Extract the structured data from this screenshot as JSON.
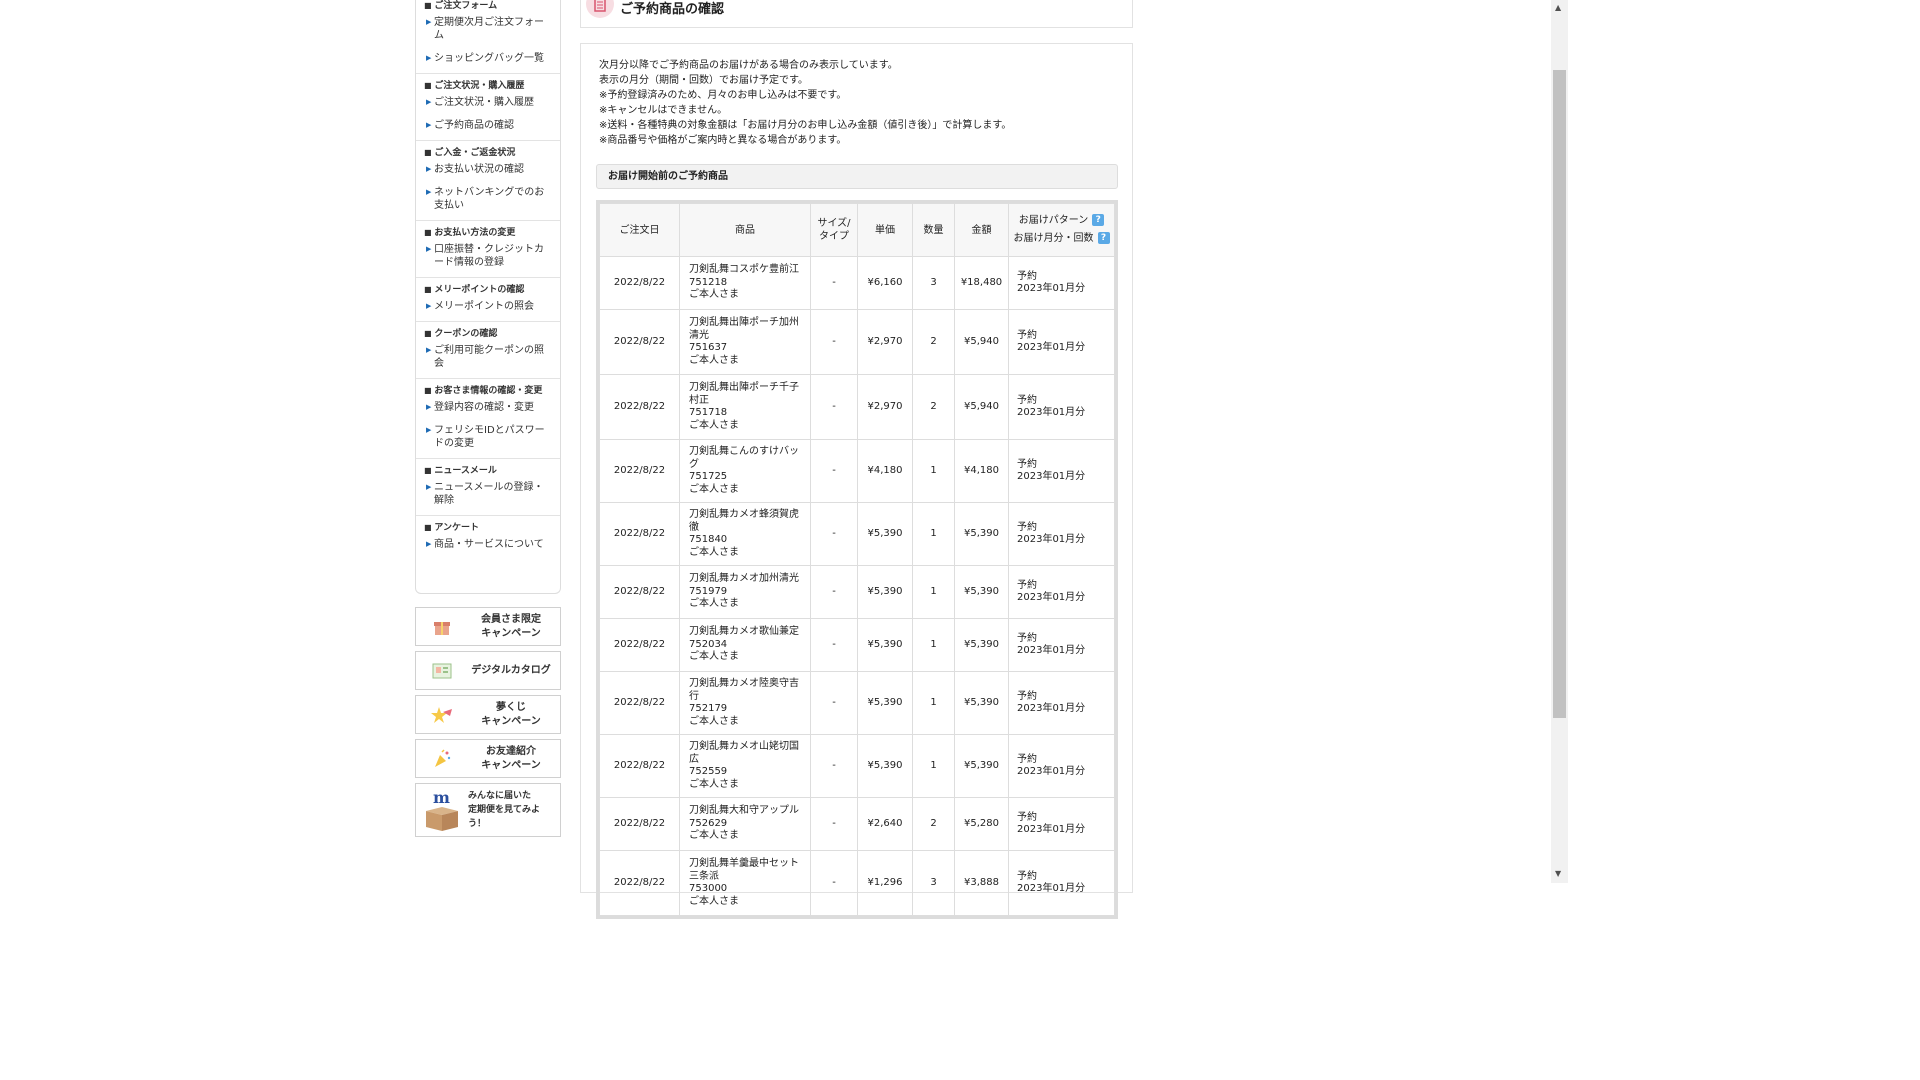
{
  "page_title": "ご予約商品の確認",
  "sidebar": {
    "sections": [
      {
        "heading": "ご注文フォーム",
        "links": [
          "定期便次月ご注文フォーム",
          "ショッピングバッグ一覧"
        ]
      },
      {
        "heading": "ご注文状況・購入履歴",
        "links": [
          "ご注文状況・購入履歴",
          "ご予約商品の確認"
        ]
      },
      {
        "heading": "ご入金・ご返金状況",
        "links": [
          "お支払い状況の確認",
          "ネットバンキングでのお支払い"
        ]
      },
      {
        "heading": "お支払い方法の変更",
        "links": [
          "口座振替・クレジットカード情報の登録"
        ]
      },
      {
        "heading": "メリーポイントの確認",
        "links": [
          "メリーポイントの照会"
        ]
      },
      {
        "heading": "クーポンの確認",
        "links": [
          "ご利用可能クーポンの照会"
        ]
      },
      {
        "heading": "お客さま情報の確認・変更",
        "links": [
          "登録内容の確認・変更",
          "フェリシモIDとパスワードの変更"
        ]
      },
      {
        "heading": "ニュースメール",
        "links": [
          "ニュースメールの登録・解除"
        ]
      },
      {
        "heading": "アンケート",
        "links": [
          "商品・サービスについて"
        ]
      }
    ]
  },
  "banners": [
    {
      "line1": "会員さま限定",
      "line2": "キャンペーン",
      "icon": "gift-icon"
    },
    {
      "line1": "デジタルカタログ",
      "line2": "",
      "icon": "catalog-icon"
    },
    {
      "line1": "夢くじ",
      "line2": "キャンペーン",
      "icon": "star-icon"
    },
    {
      "line1": "お友達紹介",
      "line2": "キャンペーン",
      "icon": "party-icon"
    },
    {
      "line1": "みんなに届いた",
      "line2": "定期便を見てみよう！",
      "icon": "box-icon"
    }
  ],
  "notes": [
    "次月分以降でご予約商品のお届けがある場合のみ表示しています。",
    "表示の月分（期間・回数）でお届け予定です。",
    "※予約登録済みのため、月々のお申し込みは不要です。",
    "※キャンセルはできません。",
    "※送料・各種特典の対象金額は「お届け月分のお申し込み金額（値引き後）」で計算します。",
    "※商品番号や価格がご案内時と異なる場合があります。"
  ],
  "section_heading": "お届け開始前のご予約商品",
  "table": {
    "headers": {
      "order_date": "ご注文日",
      "product": "商品",
      "size": "サイズ/タイプ",
      "unit_price": "単価",
      "qty": "数量",
      "amount": "金額",
      "pattern": "お届けパターン",
      "month": "お届け月分・回数",
      "help": "?"
    },
    "rows": [
      {
        "date": "2022/8/22",
        "name": "刀剣乱舞コスポケ豊前江",
        "code": "751218",
        "recipient": "ご本人さま",
        "size": "-",
        "price": "¥6,160",
        "qty": "3",
        "amount": "¥18,480",
        "pattern": "予約",
        "month": "2023年01月分"
      },
      {
        "date": "2022/8/22",
        "name": "刀剣乱舞出陣ポーチ加州清光",
        "code": "751637",
        "recipient": "ご本人さま",
        "size": "-",
        "price": "¥2,970",
        "qty": "2",
        "amount": "¥5,940",
        "pattern": "予約",
        "month": "2023年01月分"
      },
      {
        "date": "2022/8/22",
        "name": "刀剣乱舞出陣ポーチ千子村正",
        "code": "751718",
        "recipient": "ご本人さま",
        "size": "-",
        "price": "¥2,970",
        "qty": "2",
        "amount": "¥5,940",
        "pattern": "予約",
        "month": "2023年01月分"
      },
      {
        "date": "2022/8/22",
        "name": "刀剣乱舞こんのすけバッグ",
        "code": "751725",
        "recipient": "ご本人さま",
        "size": "-",
        "price": "¥4,180",
        "qty": "1",
        "amount": "¥4,180",
        "pattern": "予約",
        "month": "2023年01月分"
      },
      {
        "date": "2022/8/22",
        "name": "刀剣乱舞カメオ蜂須賀虎徹",
        "code": "751840",
        "recipient": "ご本人さま",
        "size": "-",
        "price": "¥5,390",
        "qty": "1",
        "amount": "¥5,390",
        "pattern": "予約",
        "month": "2023年01月分"
      },
      {
        "date": "2022/8/22",
        "name": "刀剣乱舞カメオ加州清光",
        "code": "751979",
        "recipient": "ご本人さま",
        "size": "-",
        "price": "¥5,390",
        "qty": "1",
        "amount": "¥5,390",
        "pattern": "予約",
        "month": "2023年01月分"
      },
      {
        "date": "2022/8/22",
        "name": "刀剣乱舞カメオ歌仙兼定",
        "code": "752034",
        "recipient": "ご本人さま",
        "size": "-",
        "price": "¥5,390",
        "qty": "1",
        "amount": "¥5,390",
        "pattern": "予約",
        "month": "2023年01月分"
      },
      {
        "date": "2022/8/22",
        "name": "刀剣乱舞カメオ陸奥守吉行",
        "code": "752179",
        "recipient": "ご本人さま",
        "size": "-",
        "price": "¥5,390",
        "qty": "1",
        "amount": "¥5,390",
        "pattern": "予約",
        "month": "2023年01月分"
      },
      {
        "date": "2022/8/22",
        "name": "刀剣乱舞カメオ山姥切国広",
        "code": "752559",
        "recipient": "ご本人さま",
        "size": "-",
        "price": "¥5,390",
        "qty": "1",
        "amount": "¥5,390",
        "pattern": "予約",
        "month": "2023年01月分"
      },
      {
        "date": "2022/8/22",
        "name": "刀剣乱舞大和守アップル",
        "code": "752629",
        "recipient": "ご本人さま",
        "size": "-",
        "price": "¥2,640",
        "qty": "2",
        "amount": "¥5,280",
        "pattern": "予約",
        "month": "2023年01月分"
      },
      {
        "date": "2022/8/22",
        "name": "刀剣乱舞羊羹最中セット三条派",
        "code": "753000",
        "recipient": "ご本人さま",
        "size": "-",
        "price": "¥1,296",
        "qty": "3",
        "amount": "¥3,888",
        "pattern": "予約",
        "month": "2023年01月分"
      }
    ]
  },
  "colors": {
    "accent": "#1d6ab4",
    "help_icon": "#5aa9e6",
    "title_icon": "#f7dde2"
  }
}
